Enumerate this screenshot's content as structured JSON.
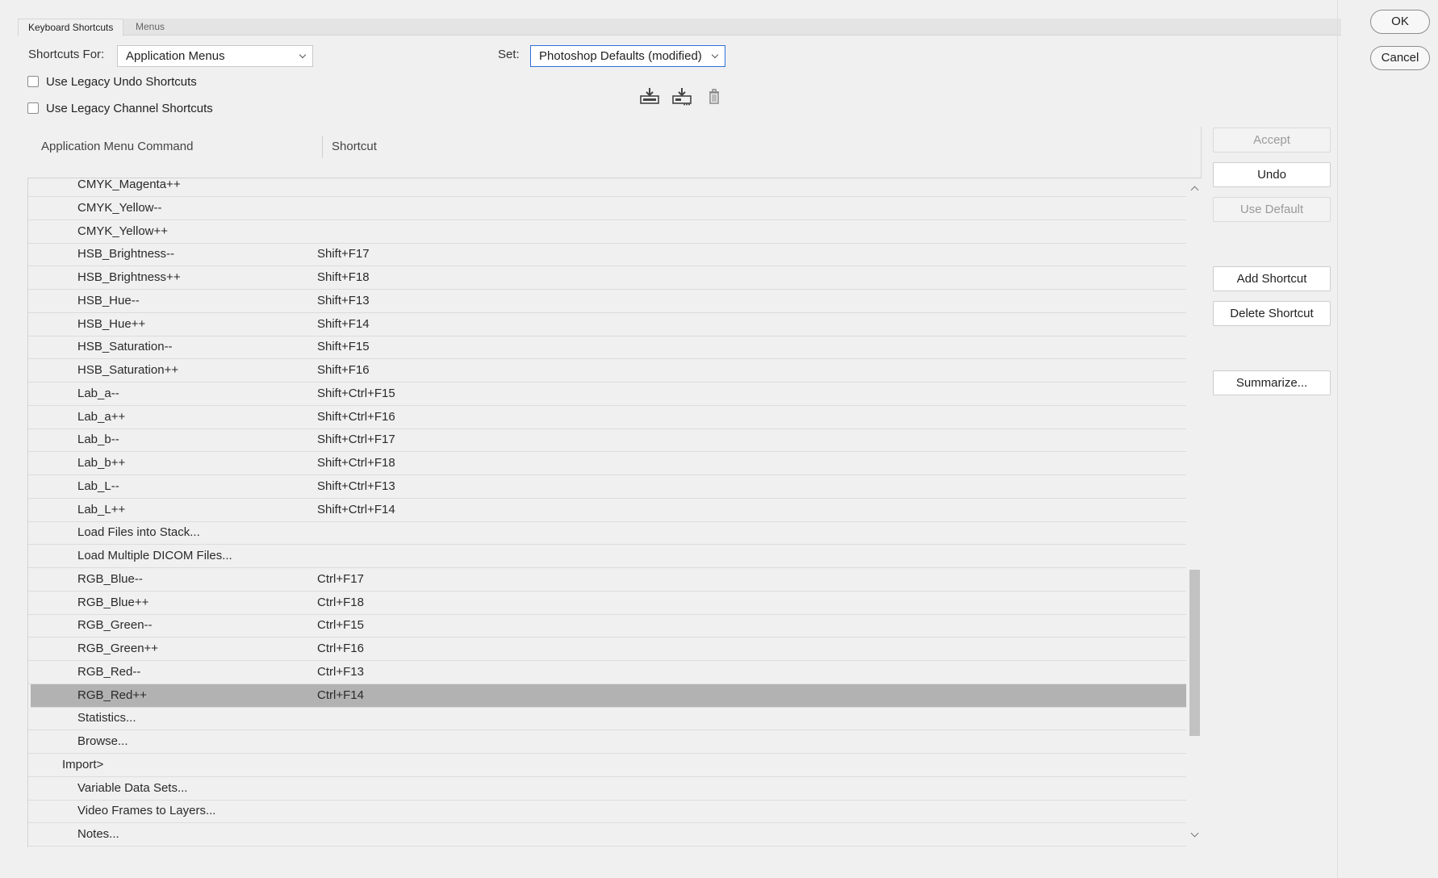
{
  "tabs": [
    {
      "label": "Keyboard Shortcuts"
    },
    {
      "label": "Menus"
    }
  ],
  "shortcuts_for": {
    "label": "Shortcuts For:",
    "value": "Application Menus"
  },
  "set": {
    "label": "Set:",
    "value": "Photoshop Defaults (modified)"
  },
  "options": {
    "legacy_undo": {
      "label": "Use Legacy Undo Shortcuts",
      "checked": false
    },
    "legacy_channel": {
      "label": "Use Legacy Channel Shortcuts",
      "checked": false
    }
  },
  "toolbar_icons": [
    "save-set-icon",
    "save-set-as-icon",
    "delete-set-icon"
  ],
  "table": {
    "col_command": "Application Menu Command",
    "col_shortcut": "Shortcut",
    "rows": [
      {
        "command": "CMYK_Magenta++",
        "shortcut": "",
        "indent": 2
      },
      {
        "command": "CMYK_Yellow--",
        "shortcut": "",
        "indent": 2
      },
      {
        "command": "CMYK_Yellow++",
        "shortcut": "",
        "indent": 2
      },
      {
        "command": "HSB_Brightness--",
        "shortcut": "Shift+F17",
        "indent": 2
      },
      {
        "command": "HSB_Brightness++",
        "shortcut": "Shift+F18",
        "indent": 2
      },
      {
        "command": "HSB_Hue--",
        "shortcut": "Shift+F13",
        "indent": 2
      },
      {
        "command": "HSB_Hue++",
        "shortcut": "Shift+F14",
        "indent": 2
      },
      {
        "command": "HSB_Saturation--",
        "shortcut": "Shift+F15",
        "indent": 2
      },
      {
        "command": "HSB_Saturation++",
        "shortcut": "Shift+F16",
        "indent": 2
      },
      {
        "command": "Lab_a--",
        "shortcut": "Shift+Ctrl+F15",
        "indent": 2
      },
      {
        "command": "Lab_a++",
        "shortcut": "Shift+Ctrl+F16",
        "indent": 2
      },
      {
        "command": "Lab_b--",
        "shortcut": "Shift+Ctrl+F17",
        "indent": 2
      },
      {
        "command": "Lab_b++",
        "shortcut": "Shift+Ctrl+F18",
        "indent": 2
      },
      {
        "command": "Lab_L--",
        "shortcut": "Shift+Ctrl+F13",
        "indent": 2
      },
      {
        "command": "Lab_L++",
        "shortcut": "Shift+Ctrl+F14",
        "indent": 2
      },
      {
        "command": "Load Files into Stack...",
        "shortcut": "",
        "indent": 2
      },
      {
        "command": "Load Multiple DICOM Files...",
        "shortcut": "",
        "indent": 2
      },
      {
        "command": "RGB_Blue--",
        "shortcut": "Ctrl+F17",
        "indent": 2
      },
      {
        "command": "RGB_Blue++",
        "shortcut": "Ctrl+F18",
        "indent": 2
      },
      {
        "command": "RGB_Green--",
        "shortcut": "Ctrl+F15",
        "indent": 2
      },
      {
        "command": "RGB_Green++",
        "shortcut": "Ctrl+F16",
        "indent": 2
      },
      {
        "command": "RGB_Red--",
        "shortcut": "Ctrl+F13",
        "indent": 2
      },
      {
        "command": "RGB_Red++",
        "shortcut": "Ctrl+F14",
        "indent": 2,
        "selected": true
      },
      {
        "command": "Statistics...",
        "shortcut": "",
        "indent": 2
      },
      {
        "command": "Browse...",
        "shortcut": "",
        "indent": 2
      },
      {
        "command": "Import>",
        "shortcut": "",
        "indent": 1
      },
      {
        "command": "Variable Data Sets...",
        "shortcut": "",
        "indent": 2
      },
      {
        "command": "Video Frames to Layers...",
        "shortcut": "",
        "indent": 2
      },
      {
        "command": "Notes...",
        "shortcut": "",
        "indent": 2
      }
    ]
  },
  "actions": {
    "accept": "Accept",
    "undo": "Undo",
    "use_default": "Use Default",
    "add_shortcut": "Add Shortcut",
    "delete_shortcut": "Delete Shortcut",
    "summarize": "Summarize..."
  },
  "dialog": {
    "ok": "OK",
    "cancel": "Cancel"
  }
}
